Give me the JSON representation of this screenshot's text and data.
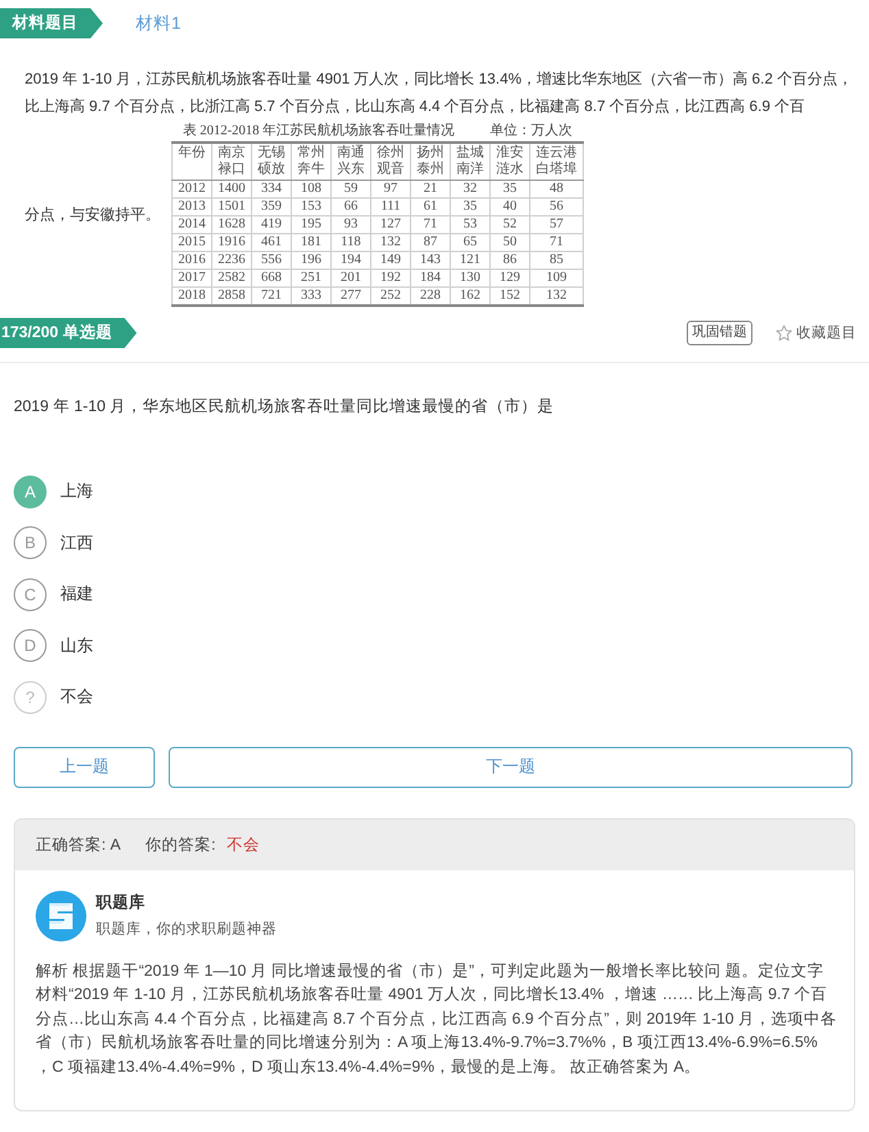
{
  "header": {
    "badge": "材料题目",
    "material_tab": "材料1"
  },
  "material": {
    "text": [
      "2019 年 1-10 月，江苏民航机场旅客吞吐量 4901 万人次，同比增长 13.4%，增速比华东地区（六省一市）高 6.2 个百分点，比上海高 9.7 个百分点，比浙江高 5.7 个百分点，比山东高 4.4 个百分点，比福建高 8.7 个百分点，比江西高 6.9 个百",
      "分点，与安徽持平。"
    ],
    "table": {
      "caption": "表 2012-2018 年江苏民航机场旅客吞吐量情况",
      "unit": "单位：万人次",
      "columns": [
        "年份",
        "南京禄口",
        "无锡硕放",
        "常州奔牛",
        "南通兴东",
        "徐州观音",
        "扬州泰州",
        "盐城南洋",
        "淮安涟水",
        "连云港白塔埠"
      ],
      "rows": [
        [
          "2012",
          "1400",
          "334",
          "108",
          "59",
          "97",
          "21",
          "32",
          "35",
          "48"
        ],
        [
          "2013",
          "1501",
          "359",
          "153",
          "66",
          "111",
          "61",
          "35",
          "40",
          "56"
        ],
        [
          "2014",
          "1628",
          "419",
          "195",
          "93",
          "127",
          "71",
          "53",
          "52",
          "57"
        ],
        [
          "2015",
          "1916",
          "461",
          "181",
          "118",
          "132",
          "87",
          "65",
          "50",
          "71"
        ],
        [
          "2016",
          "2236",
          "556",
          "196",
          "194",
          "149",
          "143",
          "121",
          "86",
          "85"
        ],
        [
          "2017",
          "2582",
          "668",
          "251",
          "201",
          "192",
          "184",
          "130",
          "129",
          "109"
        ],
        [
          "2018",
          "2858",
          "721",
          "333",
          "277",
          "252",
          "228",
          "162",
          "152",
          "132"
        ]
      ]
    }
  },
  "question": {
    "badge": "173/200 单选题",
    "review_button": "巩固错题",
    "favorite_label": "收藏题目",
    "favorited": false,
    "text": "2019 年 1-10 月，华东地区民航机场旅客吞吐量同比增速最慢的省（市）是"
  },
  "options": [
    {
      "marker": "A",
      "label": "上海",
      "kind": "choice",
      "correct": true
    },
    {
      "marker": "B",
      "label": "江西",
      "kind": "choice",
      "correct": false
    },
    {
      "marker": "C",
      "label": "福建",
      "kind": "choice",
      "correct": false
    },
    {
      "marker": "D",
      "label": "山东",
      "kind": "choice",
      "correct": false
    },
    {
      "marker": "?",
      "label": "不会",
      "kind": "skip",
      "correct": false
    }
  ],
  "nav_buttons": [
    "上一题",
    "下一题"
  ],
  "answer": {
    "correct_answer": "正确答案: A",
    "your_answer_label": "你的答案:",
    "your_answer": "不会",
    "your_answer_correct": false
  },
  "source": {
    "name": "职题库",
    "slogan": "职题库，你的求职刷题神器"
  },
  "explanation": "解析 根据题干“2019 年 1—10 月 同比增速最慢的省（市）是”，可判定此题为一般增长率比较问 题。定位文字材料“2019 年 1-10 月，江苏民航机场旅客吞吐量 4901 万人次，同比增长13.4% ，增速 …… 比上海高 9.7 个百分点…比山东高 4.4 个百分点，比福建高 8.7 个百分点，比江西高 6.9 个百分点”，则 2019年 1-10 月，选项中各省（市）民航机场旅客吞吐量的同比增速分别为：A 项上海13.4%-9.7%=3.7%%，B 项江西13.4%-6.9%=6.5% ，C 项福建13.4%-4.4%=9%，D 项山东13.4%-4.4%=9%，最慢的是上海。 故正确答案为 A。"
}
